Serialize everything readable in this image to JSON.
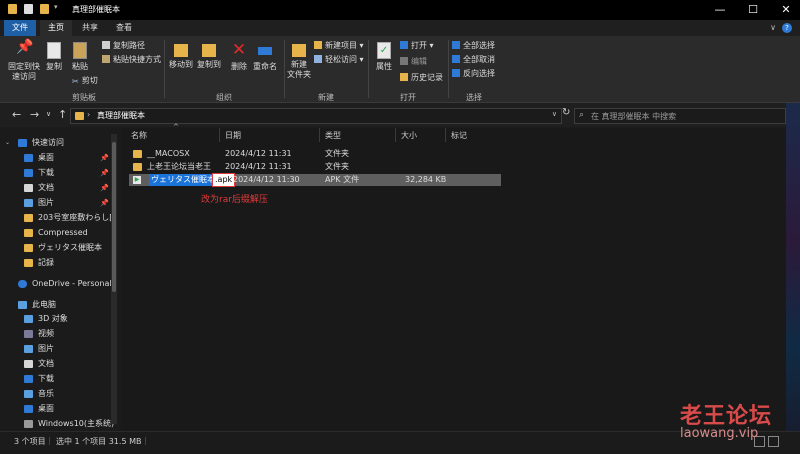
{
  "window": {
    "title": "真理部催眠本",
    "controls": [
      "minimize-icon",
      "maximize-icon",
      "close-icon"
    ]
  },
  "ribbon_tabs": [
    "文件",
    "主页",
    "共享",
    "查看"
  ],
  "ribbon": {
    "clipboard": {
      "pin_label_1": "固定到快",
      "pin_label_2": "速访问",
      "copy": "复制",
      "paste": "粘贴",
      "copy_path": "复制路径",
      "paste_shortcut": "粘贴快捷方式",
      "cut": "剪切",
      "group": "剪贴板"
    },
    "organize": {
      "move_to": "移动到",
      "copy_to": "复制到",
      "delete": "删除",
      "rename": "重命名",
      "group": "组织"
    },
    "new": {
      "new_folder_1": "新建",
      "new_folder_2": "文件夹",
      "new_item": "新建项目",
      "easy_access": "轻松访问",
      "group": "新建"
    },
    "open": {
      "properties": "属性",
      "open": "打开",
      "edit": "编辑",
      "history": "历史记录",
      "group": "打开"
    },
    "select": {
      "select_all": "全部选择",
      "select_none": "全部取消",
      "invert": "反向选择",
      "group": "选择"
    }
  },
  "address": {
    "path": "真理部催眠本",
    "search_placeholder": "在 真理部催眠本 中搜索"
  },
  "nav": {
    "quick_access": "快速访问",
    "items": [
      {
        "label": "桌面",
        "pinned": true
      },
      {
        "label": "下载",
        "pinned": true
      },
      {
        "label": "文档",
        "pinned": true
      },
      {
        "label": "图片",
        "pinned": true
      },
      {
        "label": "203号室座敷わらし[5",
        "pinned": false
      },
      {
        "label": "Compressed",
        "pinned": false
      },
      {
        "label": "ヴェリタス催眠本",
        "pinned": false
      },
      {
        "label": "記録",
        "pinned": false
      }
    ],
    "onedrive": "OneDrive - Personal",
    "this_pc": "此电脑",
    "pc_items": [
      "3D 对象",
      "视频",
      "图片",
      "文档",
      "下载",
      "音乐",
      "桌面",
      "Windows10(主系统)"
    ]
  },
  "columns": [
    "名称",
    "日期",
    "类型",
    "大小",
    "标记"
  ],
  "files": [
    {
      "name": "__MACOSX",
      "date": "2024/4/12 11:31",
      "type": "文件夹",
      "size": ""
    },
    {
      "name": "上老王论坛当老王",
      "date": "2024/4/12 11:31",
      "type": "文件夹",
      "size": ""
    },
    {
      "name_main": "ヴェリタス催眠本",
      "name_ext": ".apk",
      "date": "2024/4/12 11:30",
      "type": "APK 文件",
      "size": "32,284 KB"
    }
  ],
  "annotation": "改为rar后缀解压",
  "status": {
    "count": "3 个项目",
    "selected": "选中 1 个项目  31.5 MB"
  },
  "watermark": {
    "cn": "老王论坛",
    "url": "laowang.vip"
  },
  "colors": {
    "accent": "#1f5fa6",
    "folder": "#e6b44a",
    "annotation": "#e33b3b",
    "selection": "#5e5e5e"
  }
}
